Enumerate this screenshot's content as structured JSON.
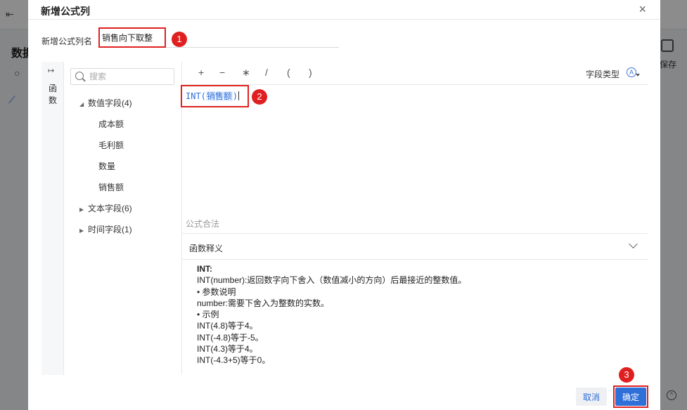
{
  "background": {
    "page_title_partial": "数据",
    "save_label": "保存"
  },
  "dialog": {
    "title": "新增公式列",
    "close_glyph": "×",
    "name_label": "新增公式列名",
    "name_value": "销售向下取整"
  },
  "left_rail": {
    "collapse_glyph": "↦",
    "label": "函数"
  },
  "field_panel": {
    "search_placeholder": "搜索",
    "groups": [
      {
        "label": "数值字段(4)",
        "expanded": true,
        "children": [
          "成本额",
          "毛利额",
          "数量",
          "销售额"
        ]
      },
      {
        "label": "文本字段(6)",
        "expanded": false
      },
      {
        "label": "时间字段(1)",
        "expanded": false
      }
    ]
  },
  "editor": {
    "operators": [
      "+",
      "−",
      "∗",
      "/",
      "(",
      ")"
    ],
    "field_type_label": "字段类型",
    "field_type_icon": "A",
    "formula_prefix": "INT(",
    "formula_field": "销售额",
    "formula_suffix": ")",
    "status": "公式合法"
  },
  "description": {
    "title": "函数释义",
    "lines": [
      "INT:",
      "INT(number):返回数字向下舍入（数值减小的方向）后最接近的整数值。",
      "• 参数说明",
      "number:需要下舍入为整数的实数。",
      "• 示例",
      "INT(4.8)等于4。",
      "INT(-4.8)等于-5。",
      "INT(4.3)等于4。",
      "INT(-4.3+5)等于0。"
    ]
  },
  "footer": {
    "cancel_label": "取消",
    "ok_label": "确定"
  },
  "annotations": [
    "1",
    "2",
    "3"
  ],
  "colors": {
    "accent": "#2f6fd8",
    "highlight": "#e02020"
  }
}
